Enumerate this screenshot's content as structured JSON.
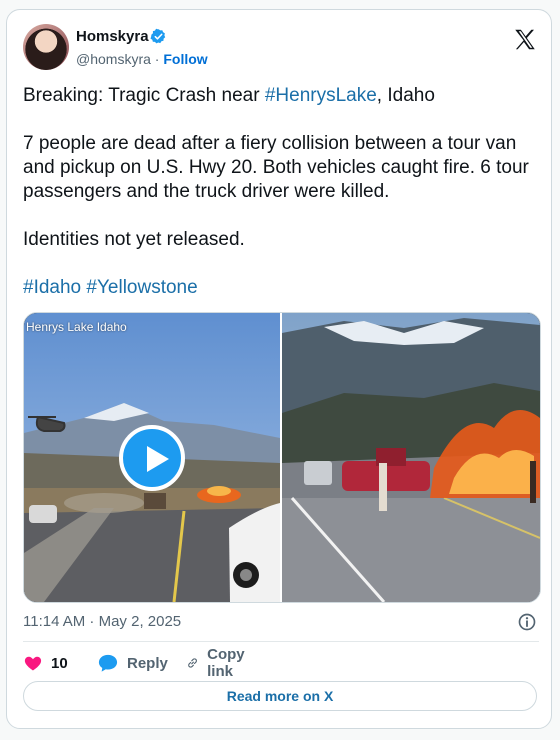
{
  "author": {
    "name": "Homskyra",
    "handle": "@homskyra",
    "separator": "·",
    "follow_label": "Follow",
    "verified": true
  },
  "tweet": {
    "line1_prefix": "Breaking: Tragic Crash near ",
    "line1_hashtag": "#HenrysLake",
    "line1_suffix": ", Idaho",
    "paragraph2": "7 people are dead after a fiery collision between a tour van and pickup on U.S. Hwy 20. Both vehicles caught fire. 6 tour passengers and the truck driver were killed.",
    "paragraph3": "Identities not yet released.",
    "hashtags": [
      "#Idaho",
      "#Yellowstone"
    ]
  },
  "media": {
    "video_caption": "Henrys Lake Idaho",
    "has_play_button": true
  },
  "meta": {
    "timestamp": "11:14 AM · May 2, 2025"
  },
  "actions": {
    "like_count": "10",
    "reply_label": "Reply",
    "copy_label": "Copy link"
  },
  "read_more_label": "Read more on X",
  "colors": {
    "accent": "#1d9bf0",
    "link": "#1b6fa8",
    "like": "#f91880",
    "muted": "#536471"
  }
}
